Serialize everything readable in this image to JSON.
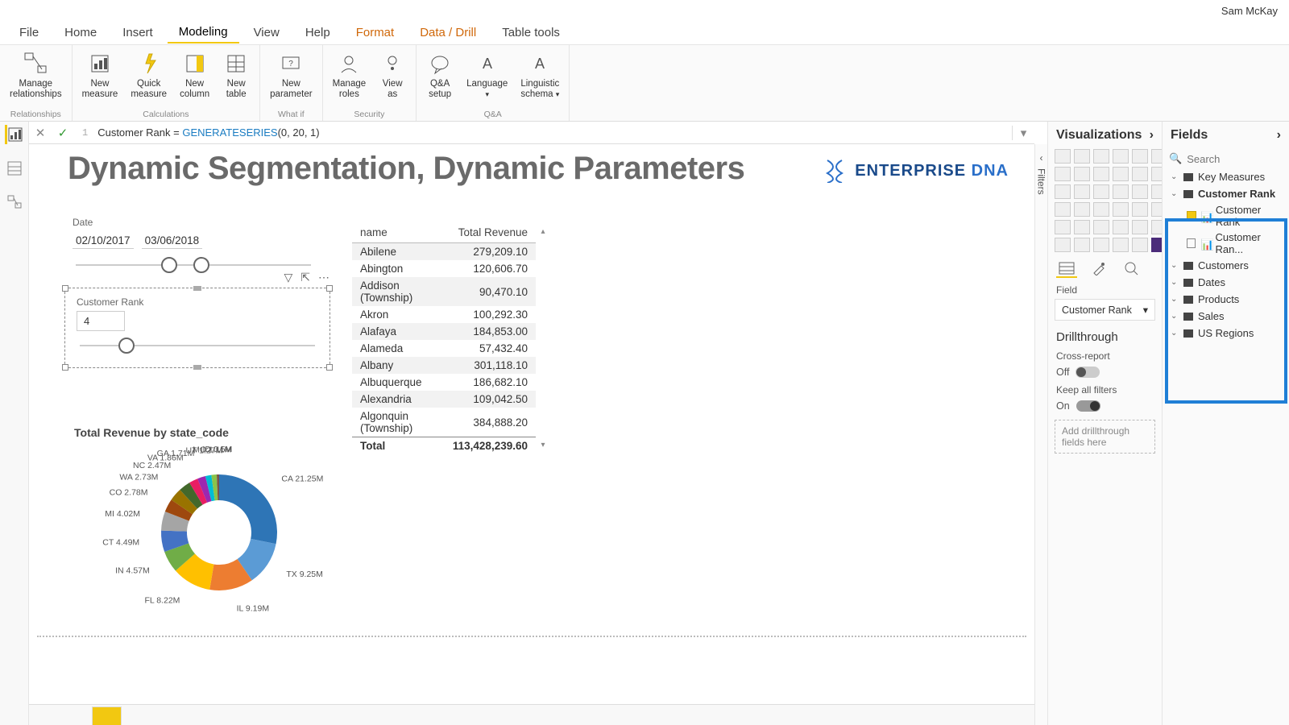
{
  "app": {
    "user": "Sam McKay"
  },
  "menu": {
    "tabs": [
      "File",
      "Home",
      "Insert",
      "Modeling",
      "View",
      "Help",
      "Format",
      "Data / Drill",
      "Table tools"
    ],
    "active": "Modeling"
  },
  "ribbon": {
    "relationships": {
      "manage": "Manage\nrelationships",
      "caption": "Relationships"
    },
    "calculations": {
      "new_measure": "New\nmeasure",
      "quick_measure": "Quick\nmeasure",
      "new_column": "New\ncolumn",
      "new_table": "New\ntable",
      "caption": "Calculations"
    },
    "whatif": {
      "new_parameter": "New\nparameter",
      "caption": "What if"
    },
    "security": {
      "manage_roles": "Manage\nroles",
      "view_as": "View\nas",
      "caption": "Security"
    },
    "qa": {
      "qa_setup": "Q&A\nsetup",
      "language": "Language",
      "linguistic": "Linguistic\nschema",
      "caption": "Q&A"
    }
  },
  "formula": {
    "gutter": "1",
    "name": "Customer Rank",
    "eq": " = ",
    "fn": "GENERATESERIES",
    "args": "(0, 20, 1)"
  },
  "canvas": {
    "title": "Dynamic Segmentation, Dynamic Parameters",
    "logo_text_a": "ENTERPRISE ",
    "logo_text_b": "DNA",
    "date_slicer": {
      "label": "Date",
      "from": "02/10/2017",
      "to": "03/06/2018"
    },
    "rank_slicer": {
      "label": "Customer Rank",
      "value": "4"
    },
    "table": {
      "cols": [
        "name",
        "Total Revenue"
      ],
      "rows": [
        [
          "Abilene",
          "279,209.10"
        ],
        [
          "Abington",
          "120,606.70"
        ],
        [
          "Addison (Township)",
          "90,470.10"
        ],
        [
          "Akron",
          "100,292.30"
        ],
        [
          "Alafaya",
          "184,853.00"
        ],
        [
          "Alameda",
          "57,432.40"
        ],
        [
          "Albany",
          "301,118.10"
        ],
        [
          "Albuquerque",
          "186,682.10"
        ],
        [
          "Alexandria",
          "109,042.50"
        ],
        [
          "Algonquin (Township)",
          "384,888.20"
        ]
      ],
      "total_label": "Total",
      "total_value": "113,428,239.60"
    },
    "donut": {
      "title": "Total Revenue by state_code",
      "labels": [
        "ID 0.5M",
        "CA 21.25M",
        "TX 9.25M",
        "IL 9.19M",
        "FL 8.22M",
        "IN 4.57M",
        "CT 4.49M",
        "MI 4.02M",
        "CO 2.78M",
        "WA 2.73M",
        "NC 2.47M",
        "VA 1.86M",
        "GA 1.71M",
        "UT 1.27M",
        "MO 1.11M"
      ]
    }
  },
  "filters_pane": {
    "label": "Filters"
  },
  "viz_pane": {
    "title": "Visualizations",
    "field_label": "Field",
    "field_value": "Customer Rank",
    "drillthrough": "Drillthrough",
    "cross_report": "Cross-report",
    "cross_state": "Off",
    "keep_filters": "Keep all filters",
    "keep_state": "On",
    "drop_hint": "Add drillthrough fields here"
  },
  "fields_pane": {
    "title": "Fields",
    "search_ph": "Search",
    "tables": [
      "Key Measures",
      "Customer Rank",
      "Customers",
      "Dates",
      "Products",
      "Sales",
      "US Regions"
    ],
    "rank_children": [
      "Customer Rank",
      "Customer Ran..."
    ]
  },
  "chart_data": {
    "type": "pie",
    "title": "Total Revenue by state_code",
    "series": [
      {
        "name": "CA",
        "value": 21.25
      },
      {
        "name": "TX",
        "value": 9.25
      },
      {
        "name": "IL",
        "value": 9.19
      },
      {
        "name": "FL",
        "value": 8.22
      },
      {
        "name": "IN",
        "value": 4.57
      },
      {
        "name": "CT",
        "value": 4.49
      },
      {
        "name": "MI",
        "value": 4.02
      },
      {
        "name": "CO",
        "value": 2.78
      },
      {
        "name": "WA",
        "value": 2.73
      },
      {
        "name": "NC",
        "value": 2.47
      },
      {
        "name": "VA",
        "value": 1.86
      },
      {
        "name": "GA",
        "value": 1.71
      },
      {
        "name": "UT",
        "value": 1.27
      },
      {
        "name": "MO",
        "value": 1.11
      },
      {
        "name": "ID",
        "value": 0.5
      }
    ],
    "unit": "M"
  }
}
